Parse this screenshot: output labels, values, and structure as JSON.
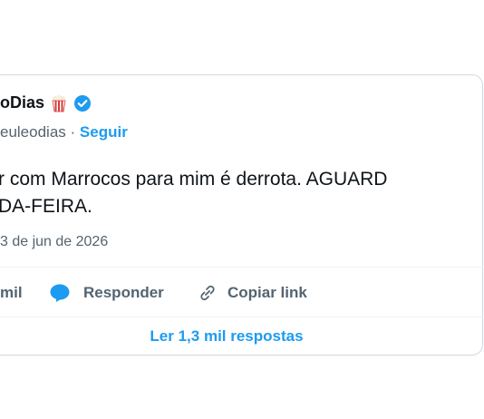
{
  "tweet": {
    "display_name_visible": "oDias",
    "handle_visible": "eulеodias",
    "separator": "·",
    "follow_label": "Seguir",
    "text_line1": "r com Marrocos para mim é derrota. AGUARD",
    "text_line2": "DA-FEIRA.",
    "timestamp_visible": "3 de jun de 2026",
    "emoji_icon": "popcorn-icon",
    "verified_icon": "verified-badge-icon"
  },
  "actions": {
    "likes_count_visible": "mil",
    "reply_label": "Responder",
    "copy_link_label": "Copiar link"
  },
  "footer": {
    "read_replies_label": "Ler 1,3 mil respostas"
  },
  "colors": {
    "accent": "#1d9bf0",
    "secondary_text": "#536471",
    "border": "#cfd9de"
  }
}
